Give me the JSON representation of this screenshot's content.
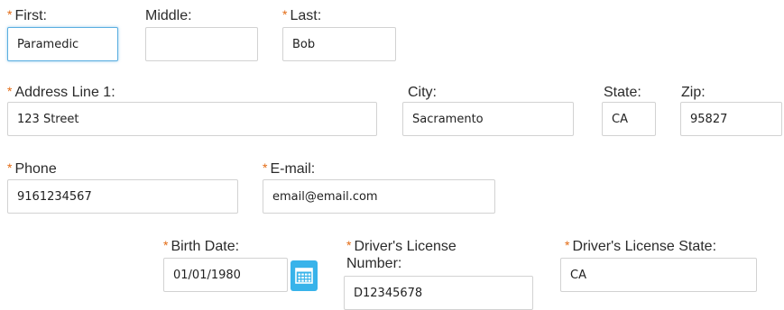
{
  "required_marker": "*",
  "name": {
    "first": {
      "label": "First:",
      "value": "Paramedic"
    },
    "middle": {
      "label": "Middle:",
      "value": ""
    },
    "last": {
      "label": "Last:",
      "value": "Bob"
    }
  },
  "address": {
    "line1": {
      "label": "Address Line 1:",
      "value": "123 Street"
    },
    "city": {
      "label": "City:",
      "value": "Sacramento"
    },
    "state": {
      "label": "State:",
      "value": "CA"
    },
    "zip": {
      "label": "Zip:",
      "value": "95827"
    }
  },
  "contact": {
    "phone": {
      "label": "Phone",
      "value": "9161234567"
    },
    "email": {
      "label": "E-mail:",
      "value": "email@email.com"
    }
  },
  "license": {
    "birth_date": {
      "label": "Birth Date:",
      "value": "01/01/1980",
      "icon": "calendar-icon"
    },
    "number": {
      "label": "Driver's License Number:",
      "value": "D12345678"
    },
    "state": {
      "label": "Driver's License State:",
      "value": "CA"
    }
  },
  "colors": {
    "required": "#e36b14",
    "focus_border": "#5aaee0",
    "calendar_button": "#38b3ea"
  }
}
